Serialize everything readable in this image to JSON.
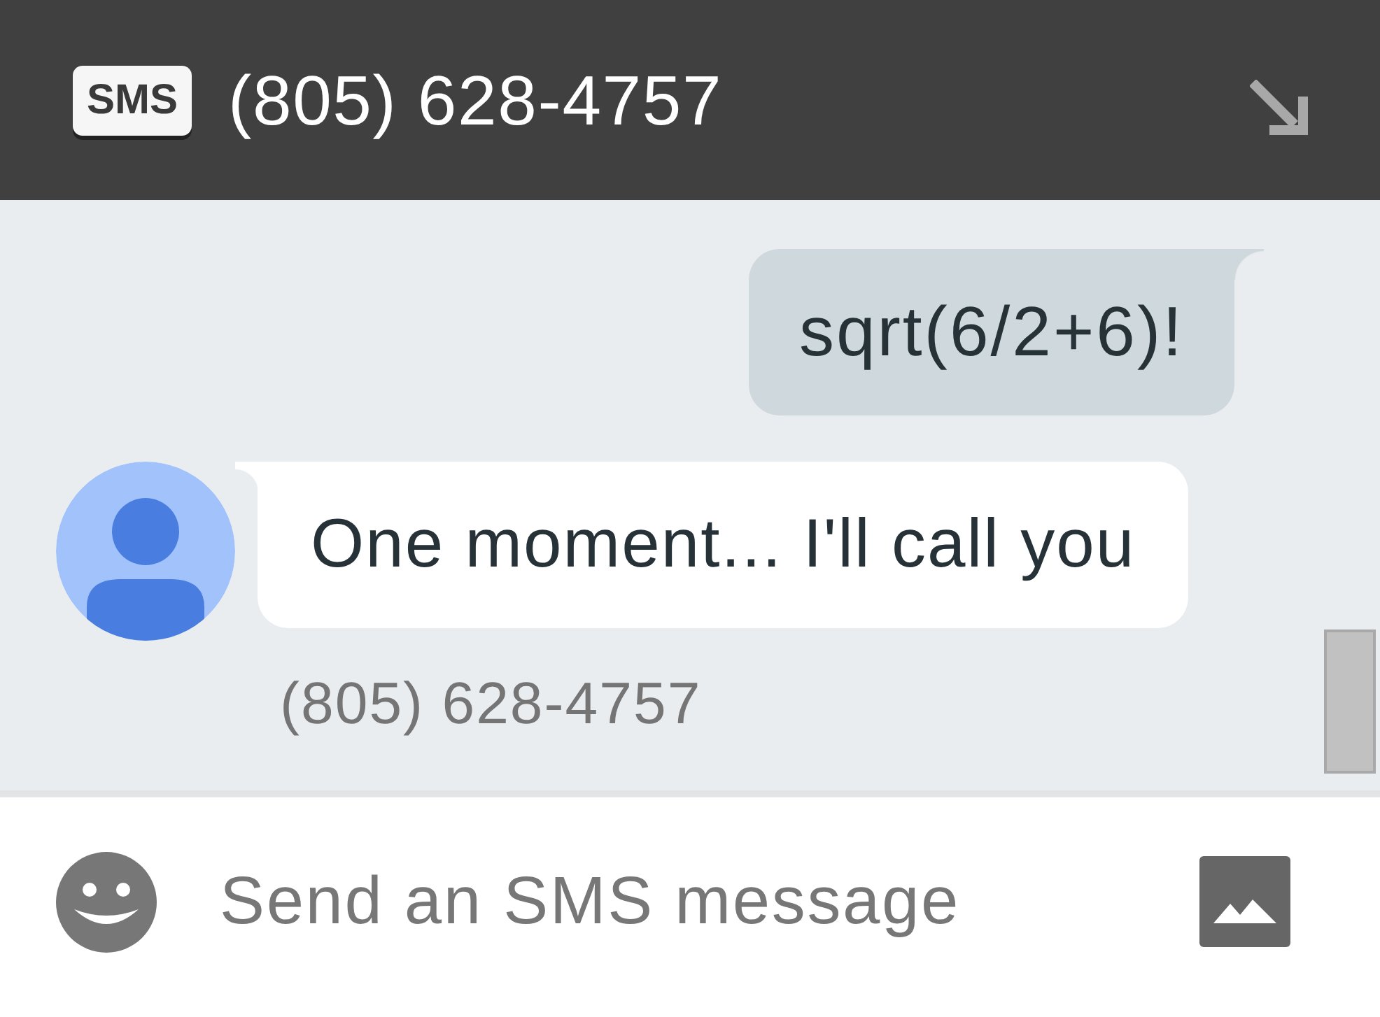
{
  "header": {
    "badge": "SMS",
    "title": "(805) 628-4757"
  },
  "messages": [
    {
      "kind": "outgoing",
      "text": "sqrt(6/2+6)!"
    },
    {
      "kind": "incoming",
      "text": "One moment... I'll call you",
      "sender": "(805) 628-4757"
    }
  ],
  "composer": {
    "placeholder": "Send an SMS message"
  }
}
